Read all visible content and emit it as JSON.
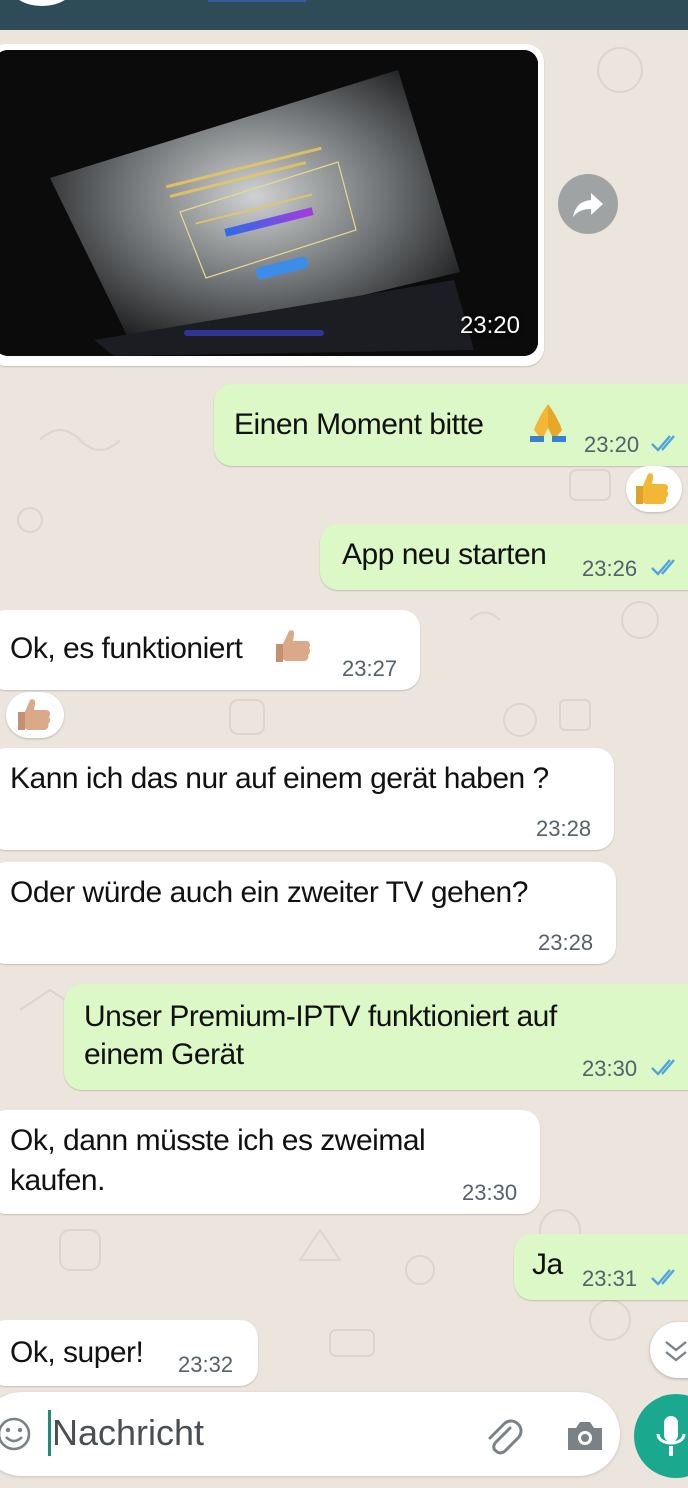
{
  "image_message": {
    "time": "23:20"
  },
  "messages": [
    {
      "id": "m1",
      "text": "Einen Moment bitte",
      "time": "23:20",
      "direction": "outgoing",
      "emoji": "folded-hands"
    },
    {
      "id": "m2",
      "text": "App neu starten",
      "time": "23:26",
      "direction": "outgoing"
    },
    {
      "id": "m3",
      "text": "Ok, es funktioniert",
      "time": "23:27",
      "direction": "incoming",
      "emoji": "thumbs-up"
    },
    {
      "id": "m4",
      "text": "Kann ich das nur auf einem gerät haben ?",
      "time": "23:28",
      "direction": "incoming"
    },
    {
      "id": "m5",
      "text": "Oder würde auch ein zweiter TV gehen?",
      "time": "23:28",
      "direction": "incoming"
    },
    {
      "id": "m6",
      "lines": [
        "Unser Premium-IPTV funktioniert auf",
        "einem Gerät"
      ],
      "time": "23:30",
      "direction": "outgoing"
    },
    {
      "id": "m7",
      "lines": [
        "Ok, dann müsste ich es zweimal",
        "kaufen."
      ],
      "time": "23:30",
      "direction": "incoming"
    },
    {
      "id": "m8",
      "text": "Ja",
      "time": "23:31",
      "direction": "outgoing"
    },
    {
      "id": "m9",
      "text": "Ok, super!",
      "time": "23:32",
      "direction": "incoming"
    }
  ],
  "composer": {
    "placeholder": "Nachricht"
  },
  "colors": {
    "header": "#2e4c58",
    "chat_background": "#ece5dd",
    "outgoing_bubble": "#dcf8c6",
    "incoming_bubble": "#ffffff",
    "read_ticks": "#4fa3e0",
    "mic_button": "#1aa88f"
  },
  "icons": [
    "forward-icon",
    "read-receipt-icon",
    "thumbs-up-reaction-icon",
    "scroll-down-icon",
    "emoji-icon",
    "attach-icon",
    "camera-icon",
    "mic-icon"
  ]
}
